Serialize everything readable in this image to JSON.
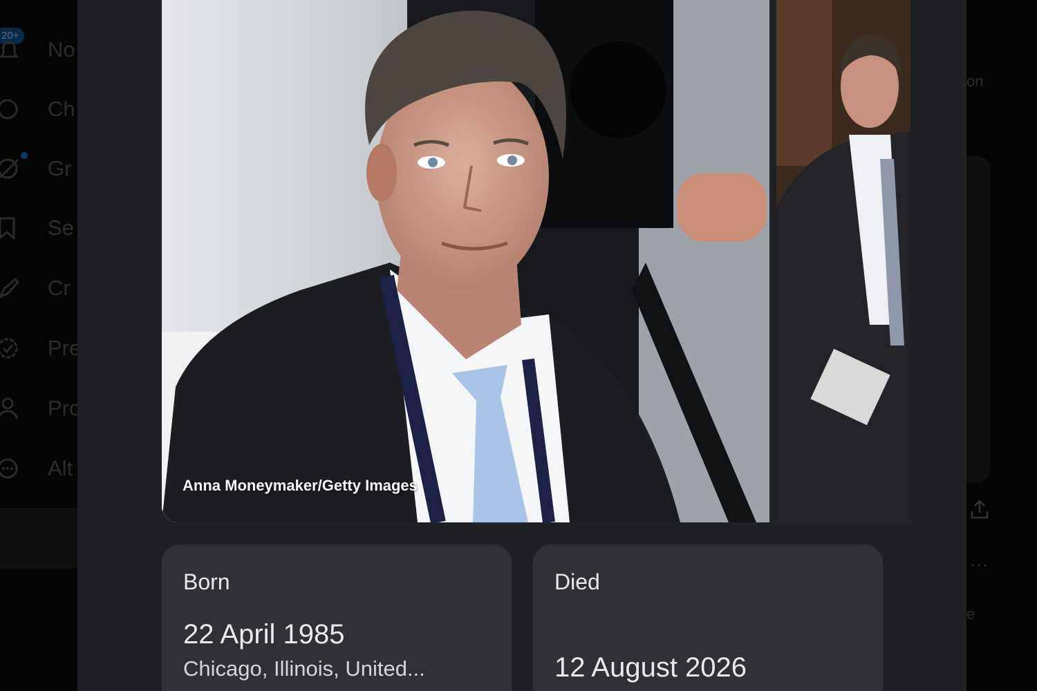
{
  "sidebar": {
    "badge": "20+",
    "items": [
      {
        "label": "Notifications",
        "icon": "bell-icon"
      },
      {
        "label": "Chat",
        "icon": "chat-icon"
      },
      {
        "label": "Grok",
        "icon": "grok-icon"
      },
      {
        "label": "Search",
        "icon": "bookmark-icon"
      },
      {
        "label": "Creator Studio",
        "icon": "rocket-icon"
      },
      {
        "label": "Premium",
        "icon": "verified-icon"
      },
      {
        "label": "Profile",
        "icon": "person-icon"
      },
      {
        "label": "More",
        "icon": "more-circle-icon"
      }
    ],
    "visible_labels": [
      "No",
      "Ch",
      "Gr",
      "Se",
      "Cr",
      "Pre",
      "Pro",
      "Alt"
    ]
  },
  "right_column": {
    "partial_text_top": "on",
    "partial_text_bottom": "e"
  },
  "knowledge_panel": {
    "photo_credit": "Anna Moneymaker/Getty Images",
    "born": {
      "label": "Born",
      "date": "22 April 1985",
      "place": "Chicago, Illinois, United..."
    },
    "died": {
      "label": "Died",
      "date": "12 August 2026"
    }
  },
  "colors": {
    "card_bg": "#202124",
    "info_card_bg": "#303134",
    "text": "#e8eaed"
  }
}
